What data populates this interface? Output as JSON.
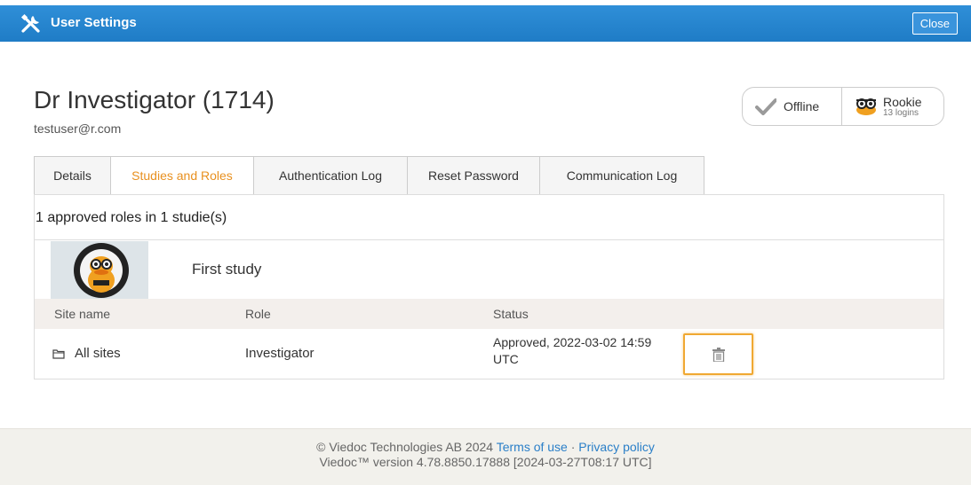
{
  "window": {
    "title": "User Settings",
    "close_label": "Close"
  },
  "user": {
    "name": "Dr Investigator (1714)",
    "email": "testuser@r.com"
  },
  "status": {
    "online_label": "Offline",
    "level_label": "Rookie",
    "logins_label": "13 logins"
  },
  "tabs": [
    {
      "label": "Details",
      "active": false
    },
    {
      "label": "Studies and Roles",
      "active": true
    },
    {
      "label": "Authentication Log",
      "active": false
    },
    {
      "label": "Reset Password",
      "active": false
    },
    {
      "label": "Communication Log",
      "active": false
    }
  ],
  "roles": {
    "summary": "1 approved roles in 1 studie(s)",
    "study_name": "First study",
    "columns": [
      "Site name",
      "Role",
      "Status"
    ],
    "rows": [
      {
        "site": "All sites",
        "role": "Investigator",
        "status_line1": "Approved, 2022-03-02 14:59",
        "status_line2": "UTC"
      }
    ]
  },
  "footer": {
    "copyright": "© Viedoc Technologies AB 2024",
    "terms_link": "Terms of use",
    "separator": "·",
    "privacy_link": "Privacy policy",
    "version": "Viedoc™ version 4.78.8850.17888 [2024-03-27T08:17 UTC]"
  },
  "colors": {
    "titlebar": "#1f7cc6",
    "active_tab": "#e8901f",
    "highlight": "#f0a832",
    "link": "#2a7fc8"
  }
}
